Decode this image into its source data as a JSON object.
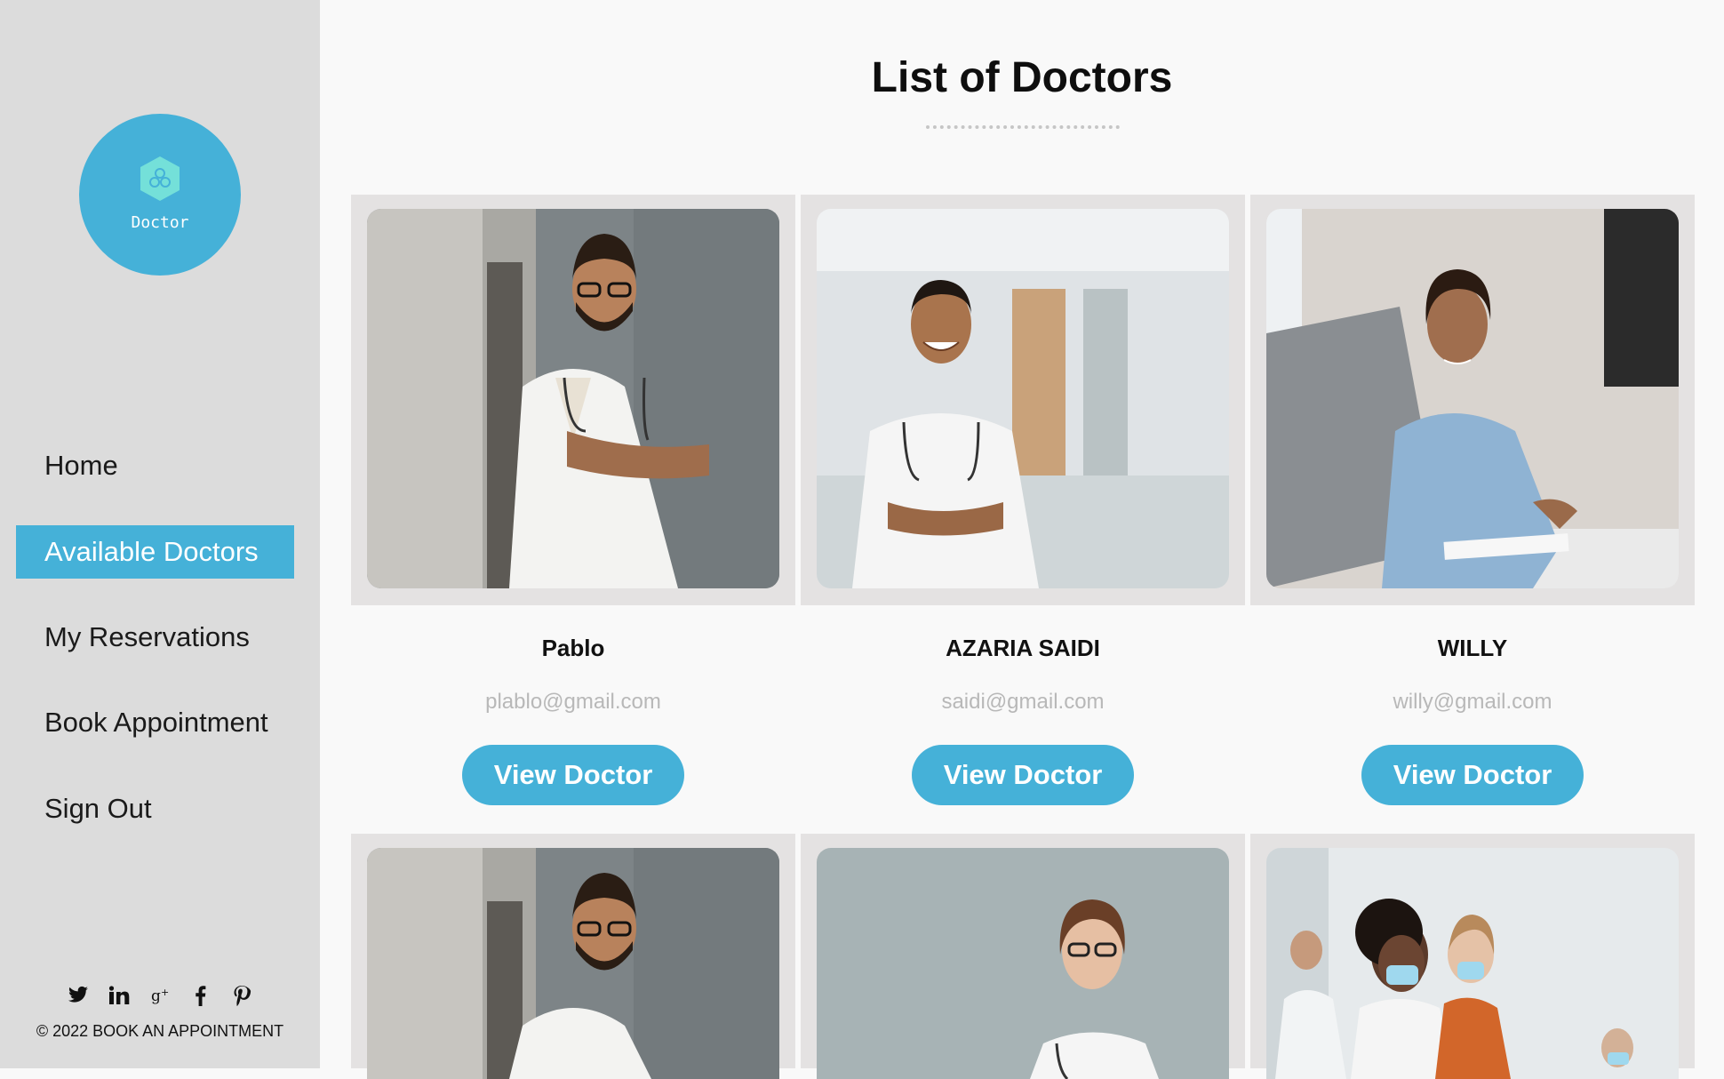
{
  "logo": {
    "text": "Doctor"
  },
  "nav": {
    "items": [
      {
        "label": "Home",
        "active": false
      },
      {
        "label": "Available Doctors",
        "active": true
      },
      {
        "label": "My Reservations",
        "active": false
      },
      {
        "label": "Book Appointment",
        "active": false
      },
      {
        "label": "Sign Out",
        "active": false
      }
    ]
  },
  "social": [
    "twitter-icon",
    "linkedin-icon",
    "google-plus-icon",
    "facebook-icon",
    "pinterest-icon"
  ],
  "footer": {
    "copyright": "© 2022 BOOK AN APPOINTMENT"
  },
  "main": {
    "title": "List of Doctors",
    "doctors": [
      {
        "name": "Pablo",
        "email": "plablo@gmail.com",
        "button": "View Doctor"
      },
      {
        "name": "AZARIA SAIDI",
        "email": "saidi@gmail.com",
        "button": "View Doctor"
      },
      {
        "name": "WILLY",
        "email": "willy@gmail.com",
        "button": "View Doctor"
      }
    ]
  },
  "colors": {
    "accent": "#45b1d8",
    "sidebar": "#dcdcdc",
    "background": "#f9f9f9"
  }
}
